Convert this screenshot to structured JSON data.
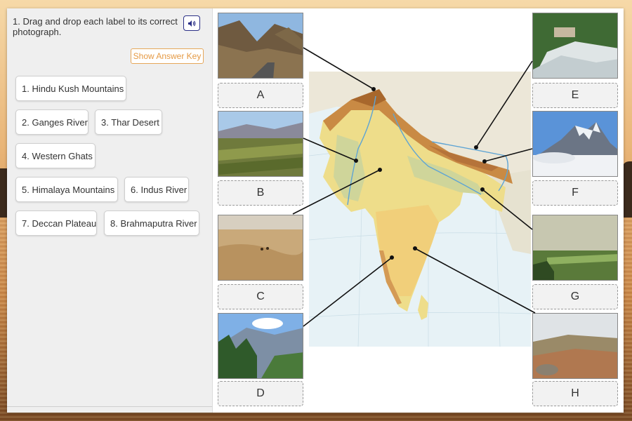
{
  "question": {
    "text": "1. Drag and drop each label to its correct photograph.",
    "audio_icon": "speaker-icon"
  },
  "answer_key_label": "Show Answer Key",
  "labels": [
    "1. Hindu Kush Mountains",
    "2. Ganges River",
    "3. Thar Desert",
    "4. Western Ghats",
    "5. Himalaya Mountains",
    "6. Indus River",
    "7. Deccan Plateau",
    "8. Brahmaputra River"
  ],
  "drop_zones": [
    "A",
    "B",
    "C",
    "D",
    "E",
    "F",
    "G",
    "H"
  ]
}
